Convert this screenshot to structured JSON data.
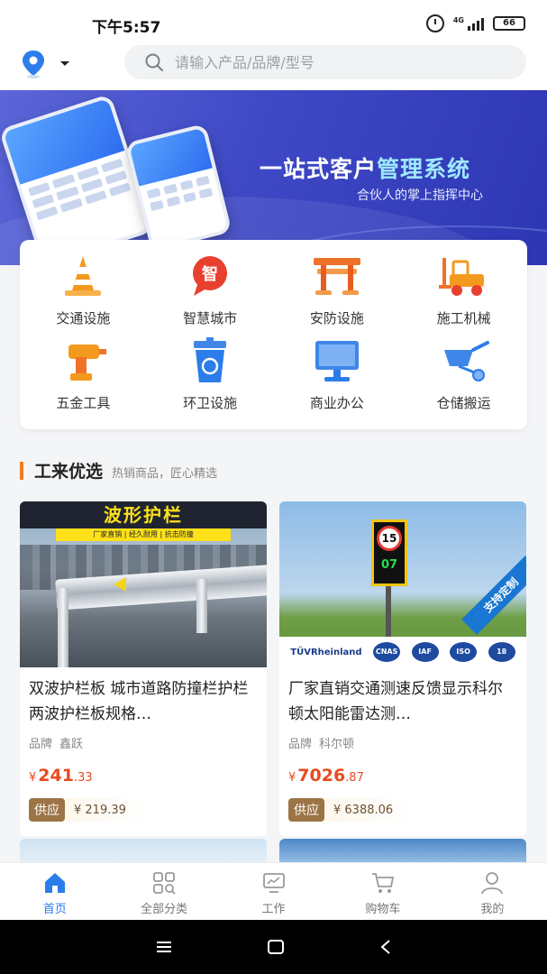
{
  "status_bar": {
    "time": "下午5:57",
    "network": "4G",
    "battery": "66"
  },
  "search": {
    "placeholder": "请输入产品/品牌/型号"
  },
  "banner": {
    "title_part1": "一站式客户",
    "title_part2": "管理系统",
    "subtitle": "合伙人的掌上指挥中心"
  },
  "categories": [
    {
      "label": "交通设施",
      "icon": "traffic-cone-icon"
    },
    {
      "label": "智慧城市",
      "icon": "smart-city-icon"
    },
    {
      "label": "安防设施",
      "icon": "barrier-icon"
    },
    {
      "label": "施工机械",
      "icon": "forklift-icon"
    },
    {
      "label": "五金工具",
      "icon": "drill-icon"
    },
    {
      "label": "环卫设施",
      "icon": "recycle-bin-icon"
    },
    {
      "label": "商业办公",
      "icon": "monitor-icon"
    },
    {
      "label": "仓储搬运",
      "icon": "wheelbarrow-icon"
    }
  ],
  "section": {
    "title": "工来优选",
    "subtitle": "热销商品，匠心精选"
  },
  "products": [
    {
      "image_text": "波形护栏",
      "image_strip": "厂家直销 | 经久耐用 | 抗击防撞",
      "name": "双波护栏板 城市道路防撞栏护栏两波护栏板规格…",
      "brand_label": "品牌",
      "brand": "鑫跃",
      "currency": "¥",
      "price": "241",
      "price_decimal": ".33",
      "supply_label": "供应",
      "supply_price": "¥ 219.39"
    },
    {
      "image_sign_speed": "15",
      "image_sign_digits": "07",
      "image_ribbon": "支持定制",
      "image_cert_tuv": "TÜVRheinland",
      "image_cert_a": "CNAS",
      "image_cert_b": "IAF",
      "image_cert_c": "ISO",
      "image_cert_d": "18",
      "name": "厂家直销交通测速反馈显示科尔顿太阳能雷达测…",
      "brand_label": "品牌",
      "brand": "科尔顿",
      "currency": "¥",
      "price": "7026",
      "price_decimal": ".87",
      "supply_label": "供应",
      "supply_price": "¥ 6388.06"
    }
  ],
  "tabs": [
    {
      "label": "首页",
      "icon": "home-icon",
      "active": true
    },
    {
      "label": "全部分类",
      "icon": "category-grid-icon",
      "active": false
    },
    {
      "label": "工作",
      "icon": "work-monitor-icon",
      "active": false
    },
    {
      "label": "购物车",
      "icon": "cart-icon",
      "active": false
    },
    {
      "label": "我的",
      "icon": "user-icon",
      "active": false
    }
  ],
  "colors": {
    "accent": "#2b7de9",
    "price": "#e94a1f",
    "section_bar": "#f07c22",
    "banner": "#3f49c6"
  }
}
